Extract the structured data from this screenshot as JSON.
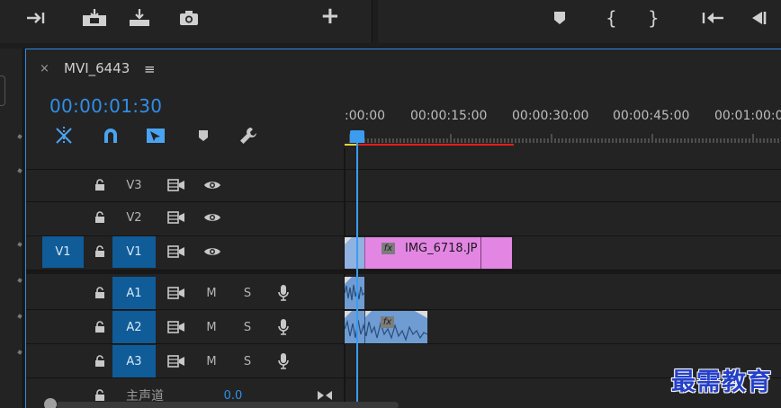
{
  "app": {
    "sequence_tab": {
      "close_glyph": "×",
      "title": "MVI_6443",
      "menu_glyph": "≡"
    },
    "timecode": "00:00:01:30"
  },
  "toolbar_icons": [
    "mark-out-icon",
    "insert-icon",
    "overwrite-icon",
    "camera-icon",
    "plus-icon",
    "marker-icon",
    "mark-in-brace-icon",
    "mark-out-brace-icon",
    "go-to-in-icon",
    "step-back-icon"
  ],
  "toolbar_text": {
    "plus": "+",
    "brace_in": "{",
    "brace_out": "}"
  },
  "timeline_controls": [
    "ripple-icon",
    "snap-magnet-icon",
    "linked-selection-icon",
    "add-marker-icon",
    "wrench-icon"
  ],
  "ruler": {
    "labels": [
      ":00:00",
      "00:00:15:00",
      "00:00:30:00",
      "00:00:45:00",
      "00:01:00:00"
    ]
  },
  "video_tracks": [
    {
      "source_patch": "",
      "name": "V3",
      "targeted": false
    },
    {
      "source_patch": "",
      "name": "V2",
      "targeted": false
    },
    {
      "source_patch": "V1",
      "name": "V1",
      "targeted": true
    }
  ],
  "audio_tracks": [
    {
      "name": "A1",
      "m": "M",
      "s": "S"
    },
    {
      "name": "A2",
      "m": "M",
      "s": "S"
    },
    {
      "name": "A3",
      "m": "M",
      "s": "S"
    }
  ],
  "master": {
    "label": "主声道",
    "value": "0.0"
  },
  "clips": {
    "video_clip_label": "IMG_6718.JP",
    "fx_label": "fx"
  },
  "watermark": "最需教育",
  "colors": {
    "accent": "#2f8fe7",
    "track_target": "#0f5c98",
    "video_clip": "#e386e3",
    "audio_clip": "#6f9cd2",
    "playhead": "#3b9cf0",
    "work_area": "#e0201a"
  }
}
